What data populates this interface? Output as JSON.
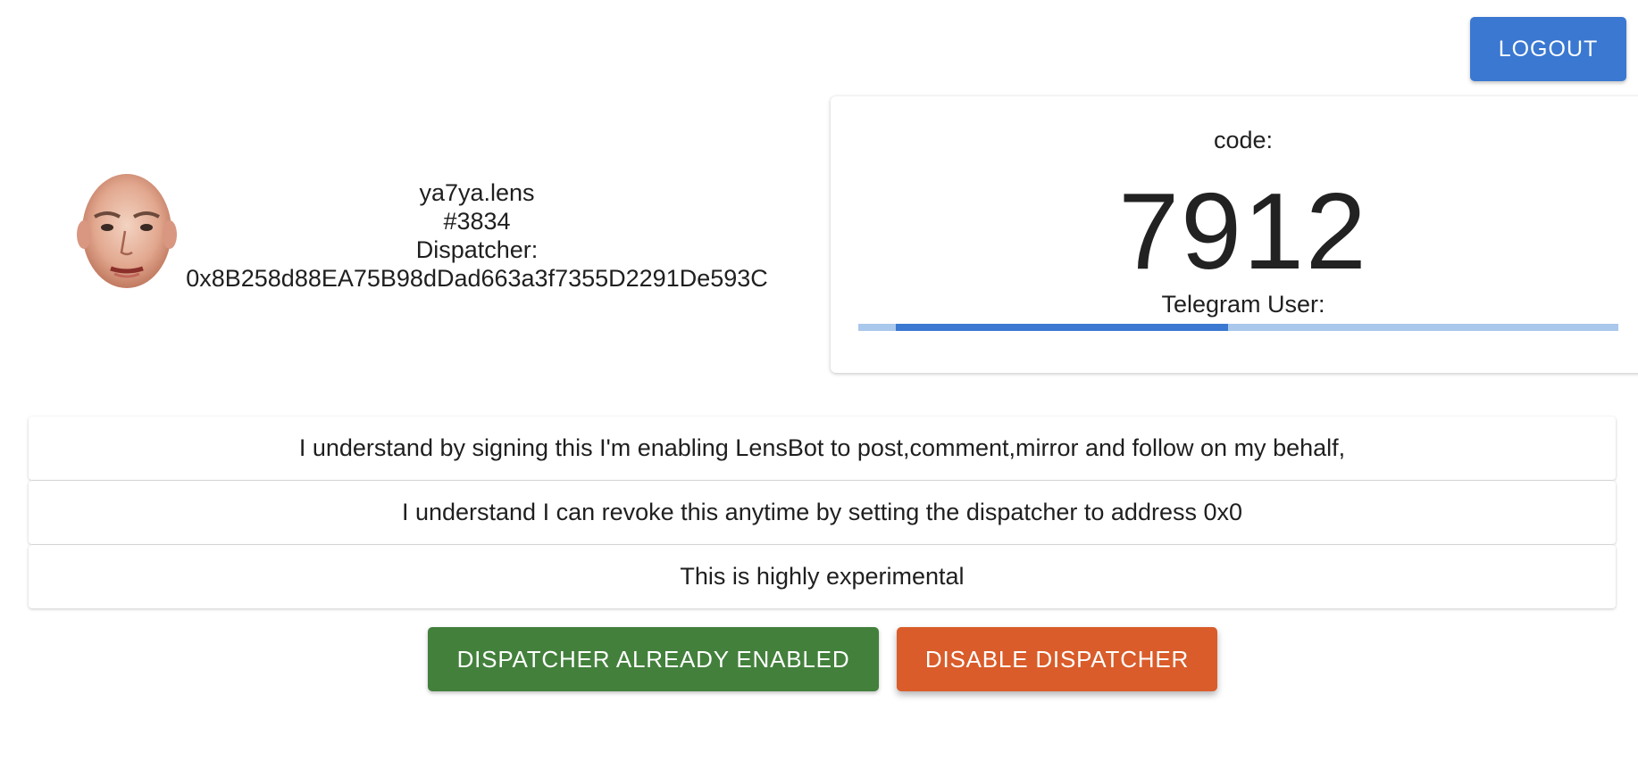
{
  "header": {
    "logout_label": "LOGOUT"
  },
  "profile": {
    "handle": "ya7ya.lens",
    "profile_id": "#3834",
    "dispatcher_label": "Dispatcher:",
    "dispatcher_address": "0x8B258d88EA75B98dDad663a3f7355D2291De593C"
  },
  "code_card": {
    "code_label": "code:",
    "code_value": "7912",
    "telegram_label": "Telegram User:",
    "progress_fraction": 0.437
  },
  "agreements": [
    "I understand by signing this I'm enabling LensBot to post,comment,mirror and follow on my behalf,",
    "I understand I can revoke this anytime by setting the dispatcher to address 0x0",
    "This is highly experimental"
  ],
  "actions": {
    "enabled_label": "DISPATCHER ALREADY ENABLED",
    "disable_label": "DISABLE DISPATCHER"
  },
  "colors": {
    "primary": "#3a78d1",
    "success": "#43803c",
    "danger": "#d95c2a"
  }
}
